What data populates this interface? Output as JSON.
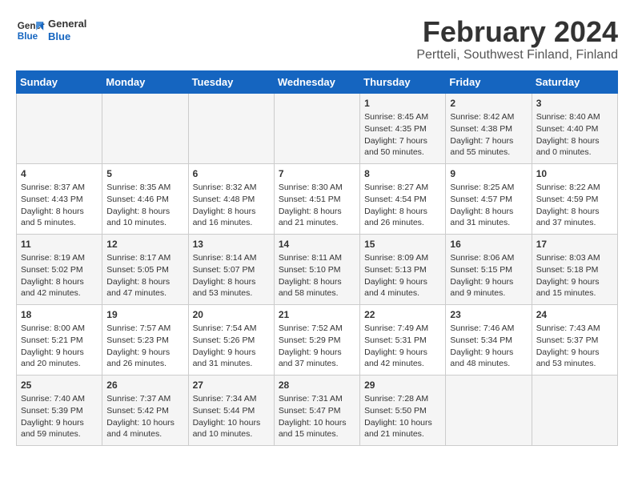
{
  "header": {
    "logo_line1": "General",
    "logo_line2": "Blue",
    "title": "February 2024",
    "subtitle": "Pertteli, Southwest Finland, Finland"
  },
  "days_of_week": [
    "Sunday",
    "Monday",
    "Tuesday",
    "Wednesday",
    "Thursday",
    "Friday",
    "Saturday"
  ],
  "weeks": [
    [
      {
        "day": "",
        "content": ""
      },
      {
        "day": "",
        "content": ""
      },
      {
        "day": "",
        "content": ""
      },
      {
        "day": "",
        "content": ""
      },
      {
        "day": "1",
        "content": "Sunrise: 8:45 AM\nSunset: 4:35 PM\nDaylight: 7 hours\nand 50 minutes."
      },
      {
        "day": "2",
        "content": "Sunrise: 8:42 AM\nSunset: 4:38 PM\nDaylight: 7 hours\nand 55 minutes."
      },
      {
        "day": "3",
        "content": "Sunrise: 8:40 AM\nSunset: 4:40 PM\nDaylight: 8 hours\nand 0 minutes."
      }
    ],
    [
      {
        "day": "4",
        "content": "Sunrise: 8:37 AM\nSunset: 4:43 PM\nDaylight: 8 hours\nand 5 minutes."
      },
      {
        "day": "5",
        "content": "Sunrise: 8:35 AM\nSunset: 4:46 PM\nDaylight: 8 hours\nand 10 minutes."
      },
      {
        "day": "6",
        "content": "Sunrise: 8:32 AM\nSunset: 4:48 PM\nDaylight: 8 hours\nand 16 minutes."
      },
      {
        "day": "7",
        "content": "Sunrise: 8:30 AM\nSunset: 4:51 PM\nDaylight: 8 hours\nand 21 minutes."
      },
      {
        "day": "8",
        "content": "Sunrise: 8:27 AM\nSunset: 4:54 PM\nDaylight: 8 hours\nand 26 minutes."
      },
      {
        "day": "9",
        "content": "Sunrise: 8:25 AM\nSunset: 4:57 PM\nDaylight: 8 hours\nand 31 minutes."
      },
      {
        "day": "10",
        "content": "Sunrise: 8:22 AM\nSunset: 4:59 PM\nDaylight: 8 hours\nand 37 minutes."
      }
    ],
    [
      {
        "day": "11",
        "content": "Sunrise: 8:19 AM\nSunset: 5:02 PM\nDaylight: 8 hours\nand 42 minutes."
      },
      {
        "day": "12",
        "content": "Sunrise: 8:17 AM\nSunset: 5:05 PM\nDaylight: 8 hours\nand 47 minutes."
      },
      {
        "day": "13",
        "content": "Sunrise: 8:14 AM\nSunset: 5:07 PM\nDaylight: 8 hours\nand 53 minutes."
      },
      {
        "day": "14",
        "content": "Sunrise: 8:11 AM\nSunset: 5:10 PM\nDaylight: 8 hours\nand 58 minutes."
      },
      {
        "day": "15",
        "content": "Sunrise: 8:09 AM\nSunset: 5:13 PM\nDaylight: 9 hours\nand 4 minutes."
      },
      {
        "day": "16",
        "content": "Sunrise: 8:06 AM\nSunset: 5:15 PM\nDaylight: 9 hours\nand 9 minutes."
      },
      {
        "day": "17",
        "content": "Sunrise: 8:03 AM\nSunset: 5:18 PM\nDaylight: 9 hours\nand 15 minutes."
      }
    ],
    [
      {
        "day": "18",
        "content": "Sunrise: 8:00 AM\nSunset: 5:21 PM\nDaylight: 9 hours\nand 20 minutes."
      },
      {
        "day": "19",
        "content": "Sunrise: 7:57 AM\nSunset: 5:23 PM\nDaylight: 9 hours\nand 26 minutes."
      },
      {
        "day": "20",
        "content": "Sunrise: 7:54 AM\nSunset: 5:26 PM\nDaylight: 9 hours\nand 31 minutes."
      },
      {
        "day": "21",
        "content": "Sunrise: 7:52 AM\nSunset: 5:29 PM\nDaylight: 9 hours\nand 37 minutes."
      },
      {
        "day": "22",
        "content": "Sunrise: 7:49 AM\nSunset: 5:31 PM\nDaylight: 9 hours\nand 42 minutes."
      },
      {
        "day": "23",
        "content": "Sunrise: 7:46 AM\nSunset: 5:34 PM\nDaylight: 9 hours\nand 48 minutes."
      },
      {
        "day": "24",
        "content": "Sunrise: 7:43 AM\nSunset: 5:37 PM\nDaylight: 9 hours\nand 53 minutes."
      }
    ],
    [
      {
        "day": "25",
        "content": "Sunrise: 7:40 AM\nSunset: 5:39 PM\nDaylight: 9 hours\nand 59 minutes."
      },
      {
        "day": "26",
        "content": "Sunrise: 7:37 AM\nSunset: 5:42 PM\nDaylight: 10 hours\nand 4 minutes."
      },
      {
        "day": "27",
        "content": "Sunrise: 7:34 AM\nSunset: 5:44 PM\nDaylight: 10 hours\nand 10 minutes."
      },
      {
        "day": "28",
        "content": "Sunrise: 7:31 AM\nSunset: 5:47 PM\nDaylight: 10 hours\nand 15 minutes."
      },
      {
        "day": "29",
        "content": "Sunrise: 7:28 AM\nSunset: 5:50 PM\nDaylight: 10 hours\nand 21 minutes."
      },
      {
        "day": "",
        "content": ""
      },
      {
        "day": "",
        "content": ""
      }
    ]
  ]
}
